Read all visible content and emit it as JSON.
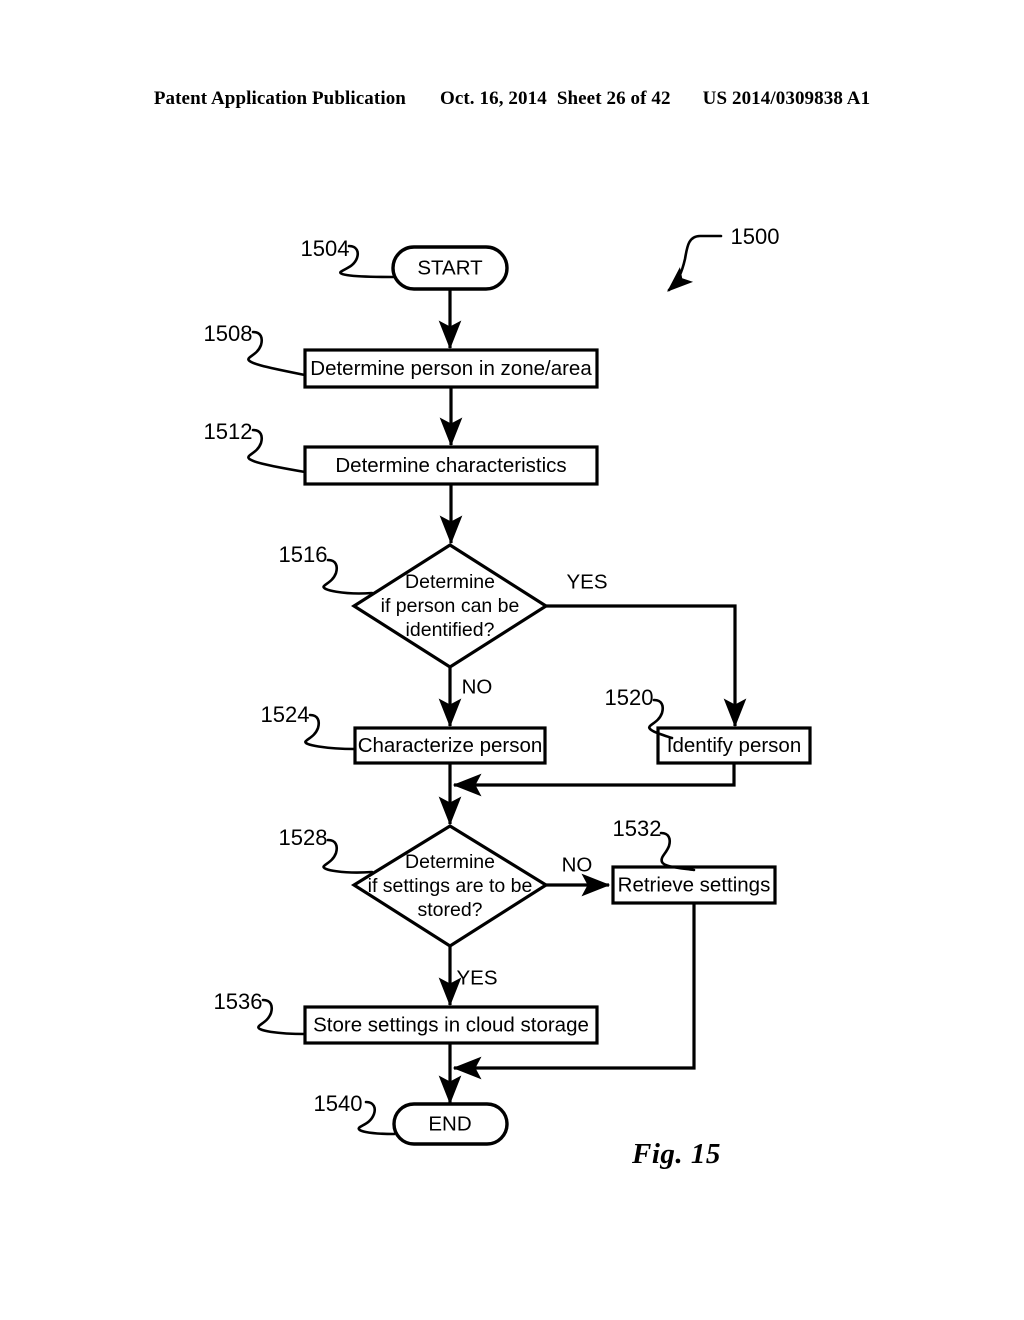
{
  "header": {
    "publication": "Patent Application Publication",
    "date": "Oct. 16, 2014",
    "sheet": "Sheet 26 of 42",
    "patent_number": "US 2014/0309838 A1"
  },
  "figure": {
    "caption": "Fig. 15",
    "diagram_ref": "1500"
  },
  "nodes": {
    "start": {
      "label": "START",
      "ref": "1504"
    },
    "determine_person": {
      "label": "Determine person in zone/area",
      "ref": "1508"
    },
    "determine_characteristics": {
      "label": "Determine characteristics",
      "ref": "1512"
    },
    "decision_identified": {
      "line1": "Determine",
      "line2": "if person can be",
      "line3": "identified?",
      "ref": "1516"
    },
    "identify_person": {
      "label": "Identify person",
      "ref": "1520"
    },
    "characterize_person": {
      "label": "Characterize person",
      "ref": "1524"
    },
    "decision_store": {
      "line1": "Determine",
      "line2": "if settings are to be",
      "line3": "stored?",
      "ref": "1528"
    },
    "retrieve_settings": {
      "label": "Retrieve settings",
      "ref": "1532"
    },
    "store_settings": {
      "label": "Store settings in cloud storage",
      "ref": "1536"
    },
    "end": {
      "label": "END",
      "ref": "1540"
    }
  },
  "branch_labels": {
    "identified_yes": "YES",
    "identified_no": "NO",
    "store_no": "NO",
    "store_yes": "YES"
  },
  "colors": {
    "ink": "#000000",
    "paper": "#ffffff"
  }
}
